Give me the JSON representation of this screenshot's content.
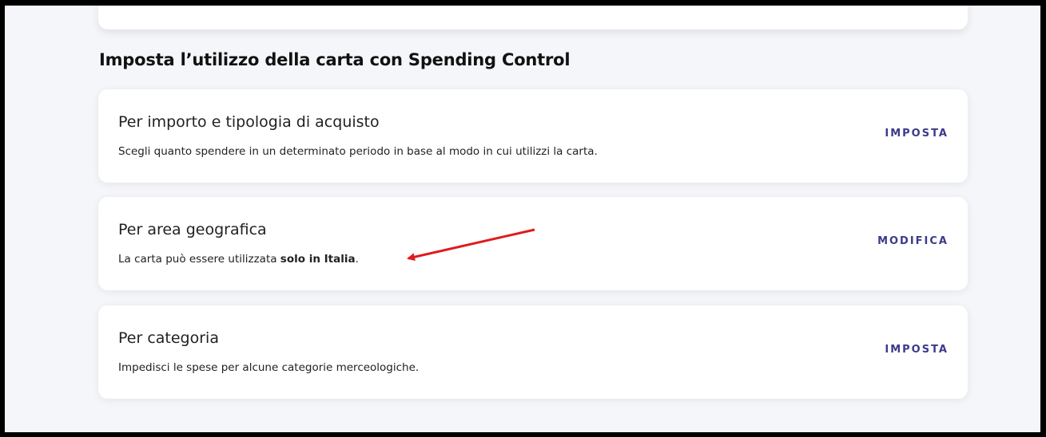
{
  "section": {
    "title": "Imposta l’utilizzo della carta con Spending Control"
  },
  "cards": [
    {
      "title": "Per importo e tipologia di acquisto",
      "description": "Scegli quanto spendere in un determinato periodo in base al modo in cui utilizzi la carta.",
      "action": "IMPOSTA"
    },
    {
      "title": "Per area geografica",
      "description_prefix": "La carta può essere utilizzata ",
      "description_bold": "solo in Italia",
      "description_suffix": ".",
      "action": "MODIFICA"
    },
    {
      "title": "Per categoria",
      "description": "Impedisci le spese per alcune categorie merceologiche.",
      "action": "IMPOSTA"
    }
  ],
  "colors": {
    "accent": "#3a3a8c",
    "annotation_arrow": "#e01b1b",
    "background": "#f5f6f9"
  }
}
